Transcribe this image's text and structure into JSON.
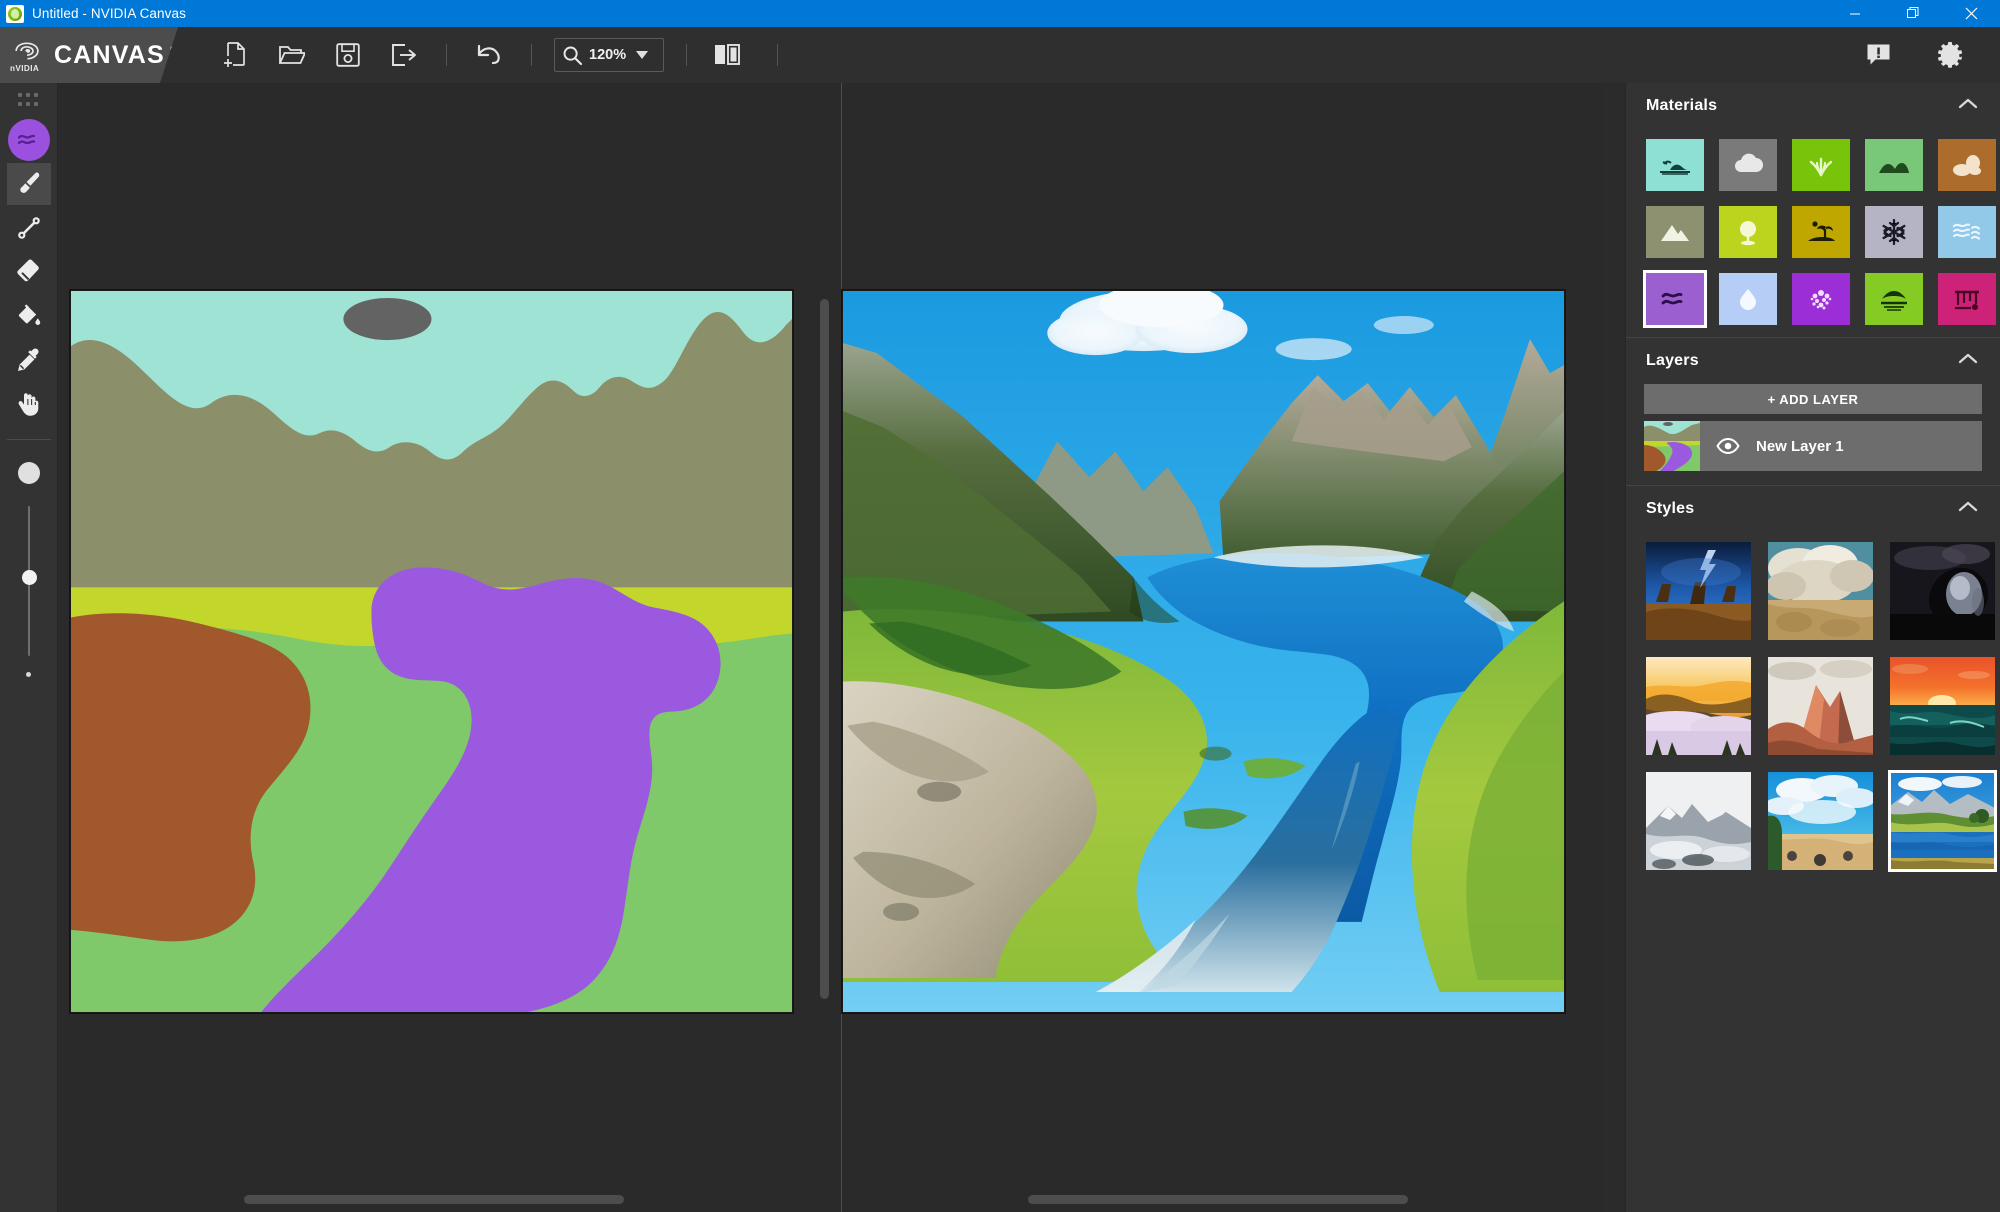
{
  "window": {
    "title": "Untitled - NVIDIA Canvas",
    "app_icon": "nvidia-canvas-icon",
    "controls": {
      "minimize": "minimize-icon",
      "restore": "restore-icon",
      "close": "close-icon"
    }
  },
  "brand": {
    "logo": "nvidia-logo",
    "logo_word": "nVIDIA",
    "name": "CANVAS",
    "tag": "BETA"
  },
  "toolbar": {
    "new_label": "new-file-icon",
    "open_label": "open-folder-icon",
    "save_label": "save-icon",
    "export_label": "export-icon",
    "undo_label": "undo-icon",
    "zoom_icon": "magnifier-icon",
    "zoom_value": "120%",
    "zoom_caret": "chevron-down-icon",
    "split_view_label": "split-view-icon",
    "feedback_label": "feedback-icon",
    "settings_label": "gear-icon"
  },
  "left_rail": {
    "grid_label": "grid-dots-icon",
    "current_material_color": "#9b51e0",
    "current_material_icon": "water-wave-icon",
    "tools": [
      {
        "name": "brush",
        "icon": "paintbrush-icon",
        "active": true
      },
      {
        "name": "line",
        "icon": "line-tool-icon",
        "active": false
      },
      {
        "name": "eraser",
        "icon": "eraser-icon",
        "active": false
      },
      {
        "name": "fill",
        "icon": "paint-bucket-icon",
        "active": false
      },
      {
        "name": "eyedropper",
        "icon": "eyedropper-icon",
        "active": false
      },
      {
        "name": "pan",
        "icon": "hand-icon",
        "active": false
      }
    ],
    "brush_preview": "brush-size-preview",
    "size_slider": {
      "name": "brush-size-slider",
      "position_pct": 43
    },
    "min_dot": "min-size-dot"
  },
  "canvas": {
    "segmentation": {
      "name": "segmentation-canvas",
      "colors": {
        "sky": "#9fe3d4",
        "cloud": "#636363",
        "mountain": "#8b8f6a",
        "bush": "#c3d62c",
        "grass": "#7fc96a",
        "dirt": "#a0582c",
        "water": "#9b59e0"
      }
    },
    "output": {
      "name": "rendered-output-canvas",
      "description": "AI rendered mountain lake landscape"
    },
    "scrollbars": {
      "left_v": true,
      "left_h": true,
      "right_h": true
    }
  },
  "panels": {
    "materials": {
      "title": "Materials",
      "collapse_icon": "chevron-up-icon",
      "items": [
        {
          "name": "cliff",
          "icon": "cliff-icon",
          "bg": "#8ee0d4",
          "fg": "#13403a",
          "selected": false
        },
        {
          "name": "cloud",
          "icon": "cloud-icon",
          "bg": "#7a7a7a",
          "fg": "#e8e8e8",
          "selected": false
        },
        {
          "name": "grass",
          "icon": "grass-icon",
          "bg": "#77c40a",
          "fg": "#e9f7c8",
          "selected": false
        },
        {
          "name": "hill",
          "icon": "hill-icon",
          "bg": "#79c779",
          "fg": "#1e4a1e",
          "selected": false
        },
        {
          "name": "rock",
          "icon": "rock-icon",
          "bg": "#ac6c2c",
          "fg": "#f3e3cd",
          "selected": false
        },
        {
          "name": "mountain",
          "icon": "mountain-icon",
          "bg": "#8d9170",
          "fg": "#f0f2e3",
          "selected": false
        },
        {
          "name": "bush",
          "icon": "bush-icon",
          "bg": "#bdd41f",
          "fg": "#f4f8d6",
          "selected": false
        },
        {
          "name": "sand",
          "icon": "sand-palm-icon",
          "bg": "#bfa700",
          "fg": "#1d1d05",
          "selected": false
        },
        {
          "name": "snow",
          "icon": "snowflake-icon",
          "bg": "#b4b4c4",
          "fg": "#1c1c28",
          "selected": false
        },
        {
          "name": "sea",
          "icon": "sea-waves-icon",
          "bg": "#92c9e8",
          "fg": "#eaf6fd",
          "selected": false
        },
        {
          "name": "water",
          "icon": "water-wave-icon",
          "bg": "#9b5fd0",
          "fg": "#2c0d4a",
          "selected": true
        },
        {
          "name": "fog",
          "icon": "droplet-icon",
          "bg": "#b6cdf5",
          "fg": "#f4f9ff",
          "selected": false
        },
        {
          "name": "flowers",
          "icon": "flowers-icon",
          "bg": "#9b2ed6",
          "fg": "#f6dcff",
          "selected": false
        },
        {
          "name": "mud",
          "icon": "mud-hill-icon",
          "bg": "#84cc23",
          "fg": "#16320a",
          "selected": false
        },
        {
          "name": "ruins",
          "icon": "ruins-icon",
          "bg": "#cc2277",
          "fg": "#4a0320",
          "selected": false
        }
      ]
    },
    "layers": {
      "title": "Layers",
      "collapse_icon": "chevron-up-icon",
      "add_label": "+ ADD LAYER",
      "rows": [
        {
          "name": "New Layer 1",
          "visible": true,
          "eye_icon": "eye-icon",
          "thumb": "layer-thumbnail"
        }
      ]
    },
    "styles": {
      "title": "Styles",
      "collapse_icon": "chevron-up-icon",
      "items": [
        {
          "name": "desert-lightning",
          "selected": false
        },
        {
          "name": "storm-clouds",
          "selected": false
        },
        {
          "name": "night-cave",
          "selected": false
        },
        {
          "name": "golden-fog",
          "selected": false
        },
        {
          "name": "red-rock-peak",
          "selected": false
        },
        {
          "name": "ocean-sunset",
          "selected": false
        },
        {
          "name": "monochrome-peaks",
          "selected": false
        },
        {
          "name": "tropical-beach",
          "selected": false
        },
        {
          "name": "alpine-lake",
          "selected": true
        }
      ]
    }
  }
}
